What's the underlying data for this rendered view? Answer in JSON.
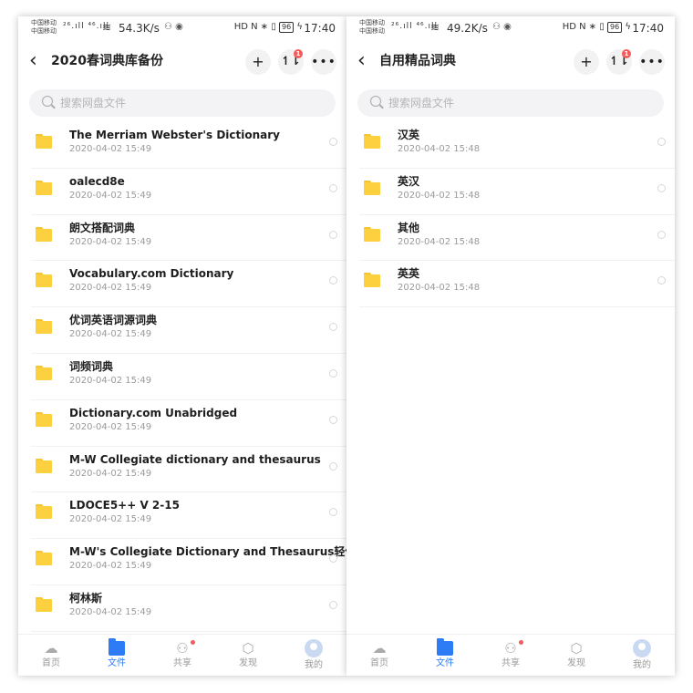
{
  "status_left": {
    "carrier_1": "中国移动",
    "carrier_2": "中国移动",
    "network": "²⁶.ıll ⁴⁶.ıll",
    "speed": "54.3K/s",
    "battery": "96",
    "time": "17:40",
    "icons_text": "HD N ∗ ▯ "
  },
  "status_right": {
    "carrier_1": "中国移动",
    "carrier_2": "中国移动",
    "network": "²⁶.ıll ⁴⁶.ıll",
    "speed": "49.2K/s",
    "battery": "96",
    "time": "17:40",
    "icons_text": "HD N ∗ ▯ "
  },
  "left_panel": {
    "title": "2020春词典库备份",
    "search_placeholder": "搜索网盘文件",
    "sort_badge": "1",
    "items": [
      {
        "name": "The Merriam Webster's Dictionary",
        "date": "2020-04-02  15:49"
      },
      {
        "name": "oalecd8e",
        "date": "2020-04-02  15:49"
      },
      {
        "name": "朗文搭配词典",
        "date": "2020-04-02  15:49"
      },
      {
        "name": "Vocabulary.com Dictionary",
        "date": "2020-04-02  15:49"
      },
      {
        "name": "优词英语词源词典",
        "date": "2020-04-02  15:49"
      },
      {
        "name": "词频词典",
        "date": "2020-04-02  15:49"
      },
      {
        "name": "Dictionary.com Unabridged",
        "date": "2020-04-02  15:49"
      },
      {
        "name": "M-W Collegiate dictionary and thesaurus",
        "date": "2020-04-02  15:49"
      },
      {
        "name": "LDOCE5++ V 2-15",
        "date": "2020-04-02  15:49"
      },
      {
        "name": "M-W's Collegiate Dictionary and Thesaurus轻体版",
        "date": "2020-04-02  15:49"
      },
      {
        "name": "柯林斯",
        "date": "2020-04-02  15:49"
      }
    ]
  },
  "right_panel": {
    "title": "自用精品词典",
    "search_placeholder": "搜索网盘文件",
    "sort_badge": "1",
    "items": [
      {
        "name": "汉英",
        "date": "2020-04-02  15:48"
      },
      {
        "name": "英汉",
        "date": "2020-04-02  15:48"
      },
      {
        "name": "其他",
        "date": "2020-04-02  15:48"
      },
      {
        "name": "英英",
        "date": "2020-04-02  15:48"
      }
    ]
  },
  "nav": {
    "home": "首页",
    "files": "文件",
    "share": "共享",
    "discover": "发现",
    "mine": "我的"
  },
  "colors": {
    "accent": "#2d7cf6",
    "folder": "#fcd03f",
    "badge": "#f25b5b"
  }
}
